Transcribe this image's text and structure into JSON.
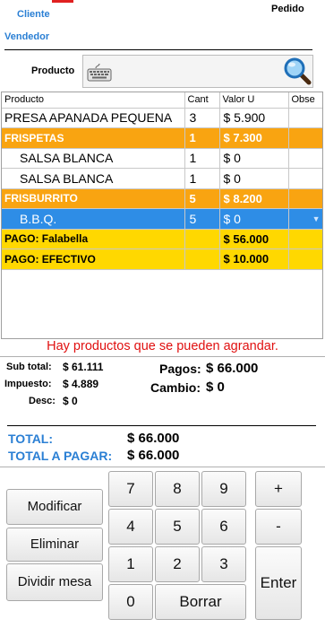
{
  "header": {
    "cliente_label": "Cliente",
    "vendedor_label": "Vendedor",
    "pedido_label": "Pedido",
    "producto_label": "Producto"
  },
  "icons": [
    "keyboard-icon",
    "search-icon"
  ],
  "colors": {
    "accent_blue": "#2a7fd4",
    "combo_orange": "#f9a411",
    "selected_blue": "#2e8de6",
    "payment_yellow": "#ffd800",
    "warning_red": "#e01010"
  },
  "grid": {
    "columns": [
      "Producto",
      "Cant",
      "Valor U",
      "Obse"
    ],
    "rows": [
      {
        "producto": "PRESA APANADA PEQUENA",
        "cant": "3",
        "valor": "$ 5.900",
        "obse": ""
      },
      {
        "producto": "FRISPETAS",
        "cant": "1",
        "valor": "$ 7.300",
        "obse": ""
      },
      {
        "producto": "SALSA BLANCA",
        "cant": "1",
        "valor": "$ 0",
        "obse": ""
      },
      {
        "producto": "SALSA BLANCA",
        "cant": "1",
        "valor": "$ 0",
        "obse": ""
      },
      {
        "producto": "FRISBURRITO",
        "cant": "5",
        "valor": "$ 8.200",
        "obse": ""
      },
      {
        "producto": "B.B.Q.",
        "cant": "5",
        "valor": "$ 0",
        "obse": ""
      },
      {
        "producto": "PAGO: Falabella",
        "cant": "",
        "valor": "$ 56.000",
        "obse": ""
      },
      {
        "producto": "PAGO: EFECTIVO",
        "cant": "",
        "valor": "$ 10.000",
        "obse": ""
      }
    ]
  },
  "warning": "Hay productos que se pueden agrandar.",
  "totals": {
    "subtotal_label": "Sub total:",
    "subtotal_value": "$ 61.111",
    "impuesto_label": "Impuesto:",
    "impuesto_value": "$ 4.889",
    "desc_label": "Desc:",
    "desc_value": "$ 0",
    "pagos_label": "Pagos:",
    "pagos_value": "$ 66.000",
    "cambio_label": "Cambio:",
    "cambio_value": "$ 0",
    "total_label": "TOTAL:",
    "total_value": "$ 66.000",
    "total_pagar_label": "TOTAL A PAGAR:",
    "total_pagar_value": "$ 66.000"
  },
  "buttons": {
    "modificar": "Modificar",
    "eliminar": "Eliminar",
    "dividir": "Dividir mesa",
    "borrar": "Borrar",
    "enter": "Enter",
    "plus": "+",
    "minus": "-"
  },
  "keypad": [
    "7",
    "8",
    "9",
    "4",
    "5",
    "6",
    "1",
    "2",
    "3",
    "0"
  ]
}
